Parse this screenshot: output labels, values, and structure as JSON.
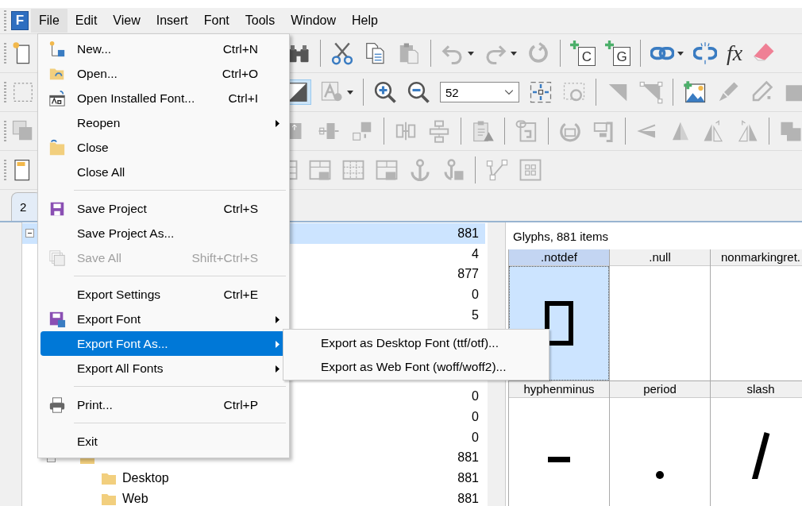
{
  "app_logo": {
    "letter": "F"
  },
  "menubar": [
    {
      "label": "File",
      "selected": true
    },
    {
      "label": "Edit",
      "selected": false
    },
    {
      "label": "View",
      "selected": false
    },
    {
      "label": "Insert",
      "selected": false
    },
    {
      "label": "Font",
      "selected": false
    },
    {
      "label": "Tools",
      "selected": false
    },
    {
      "label": "Window",
      "selected": false
    },
    {
      "label": "Help",
      "selected": false
    }
  ],
  "toolbar": {
    "add_character_letter": "C",
    "add_glyph_letter": "G",
    "formula_label": "fx",
    "zoom_value": "52"
  },
  "tab": {
    "label": "2",
    "selected": true
  },
  "tree": {
    "count": "881",
    "selected": true,
    "expanded": true,
    "children": [
      {
        "count": "4",
        "selected": false
      },
      {
        "count": "877",
        "selected": false
      },
      {
        "count": "0",
        "selected": false
      },
      {
        "count": "5",
        "selected": false
      },
      {
        "selected": false
      },
      {
        "selected": false
      },
      {
        "selected": false
      },
      {
        "count": "0",
        "selected": false
      },
      {
        "count": "0",
        "selected": false
      },
      {
        "count": "0",
        "selected": false
      },
      {
        "count": "881",
        "selected": false,
        "expanded": true,
        "children": [
          {
            "label": "Desktop",
            "count": "881",
            "selected": false
          },
          {
            "label": "Web",
            "count": "881",
            "selected": false
          }
        ]
      }
    ]
  },
  "glyph_panel": {
    "title": "Glyphs, 881 items",
    "glyphs": [
      {
        "name": ".notdef",
        "kind": "notdef",
        "selected": true
      },
      {
        "name": ".null",
        "kind": "empty",
        "selected": false
      },
      {
        "name": "nonmarkingret.",
        "kind": "empty",
        "selected": false
      },
      {
        "name": "hyphenminus",
        "kind": "hyphen",
        "selected": false
      },
      {
        "name": "period",
        "kind": "period",
        "selected": false
      },
      {
        "name": "slash",
        "kind": "slash",
        "selected": false
      }
    ]
  },
  "file_menu": {
    "items": [
      {
        "kind": "item",
        "label": "New...",
        "shortcut": "Ctrl+N",
        "submenu": false,
        "disabled": false,
        "selected": false
      },
      {
        "kind": "item",
        "label": "Open...",
        "shortcut": "Ctrl+O",
        "submenu": false,
        "disabled": false,
        "selected": false
      },
      {
        "kind": "item",
        "label": "Open Installed Font...",
        "shortcut": "Ctrl+I",
        "submenu": false,
        "disabled": false,
        "selected": false
      },
      {
        "kind": "item",
        "label": "Reopen",
        "submenu": true,
        "disabled": false,
        "selected": false
      },
      {
        "kind": "item",
        "label": "Close",
        "submenu": false,
        "disabled": false,
        "selected": false
      },
      {
        "kind": "item",
        "label": "Close All",
        "submenu": false,
        "disabled": false,
        "selected": false
      },
      {
        "kind": "separator"
      },
      {
        "kind": "item",
        "label": "Save Project",
        "shortcut": "Ctrl+S",
        "submenu": false,
        "disabled": false,
        "selected": false
      },
      {
        "kind": "item",
        "label": "Save Project As...",
        "submenu": false,
        "disabled": false,
        "selected": false
      },
      {
        "kind": "item",
        "label": "Save All",
        "shortcut": "Shift+Ctrl+S",
        "submenu": false,
        "disabled": true,
        "selected": false
      },
      {
        "kind": "separator"
      },
      {
        "kind": "item",
        "label": "Export Settings",
        "shortcut": "Ctrl+E",
        "submenu": false,
        "disabled": false,
        "selected": false
      },
      {
        "kind": "item",
        "label": "Export Font",
        "submenu": true,
        "disabled": false,
        "selected": false
      },
      {
        "kind": "item",
        "label": "Export Font As...",
        "submenu": true,
        "disabled": false,
        "selected": true
      },
      {
        "kind": "item",
        "label": "Export All Fonts",
        "submenu": true,
        "disabled": false,
        "selected": false
      },
      {
        "kind": "separator"
      },
      {
        "kind": "item",
        "label": "Print...",
        "shortcut": "Ctrl+P",
        "submenu": false,
        "disabled": false,
        "selected": false
      },
      {
        "kind": "separator"
      },
      {
        "kind": "item",
        "label": "Exit",
        "submenu": false,
        "disabled": false,
        "selected": false
      }
    ]
  },
  "submenu": {
    "items": [
      {
        "label": "Export as Desktop Font (ttf/otf)..."
      },
      {
        "label": "Export as Web Font (woff/woff2)..."
      }
    ]
  }
}
